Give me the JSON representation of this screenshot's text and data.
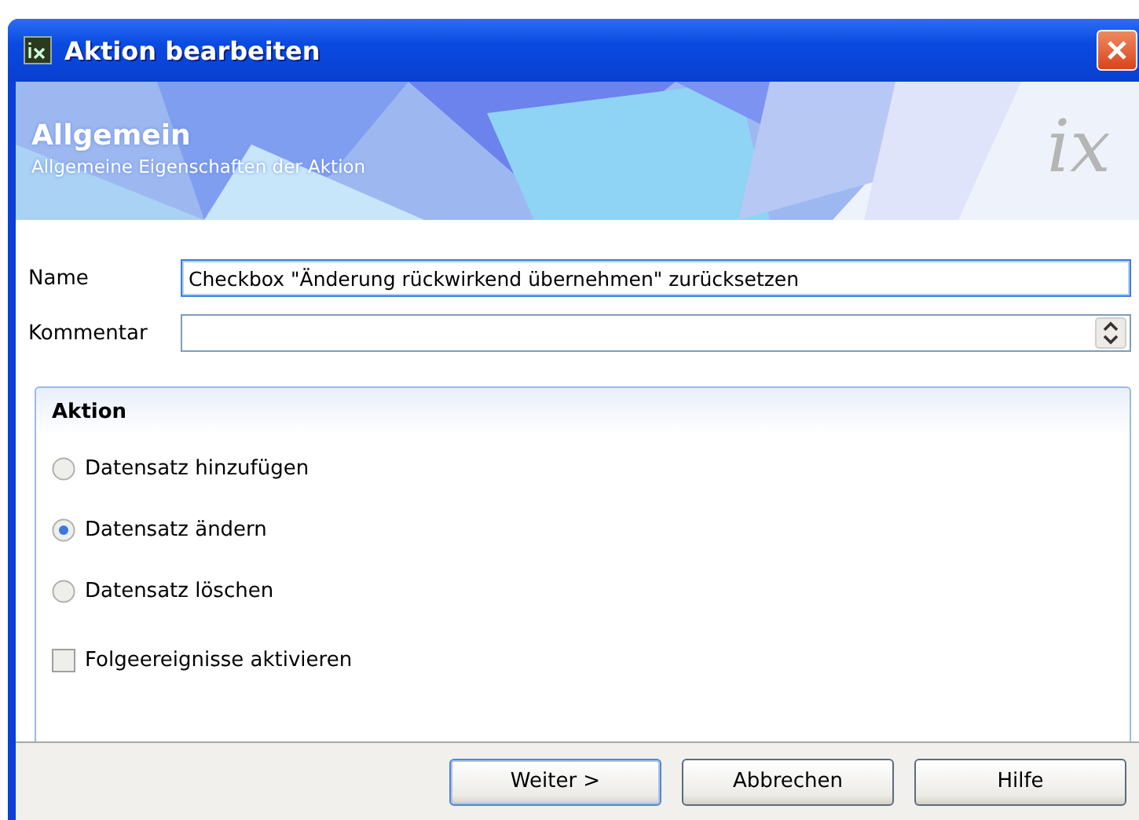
{
  "window": {
    "title": "Aktion bearbeiten"
  },
  "header": {
    "title": "Allgemein",
    "subtitle": "Allgemeine Eigenschaften der Aktion",
    "logo": "ix"
  },
  "fields": [
    {
      "label": "Name",
      "value": "Checkbox \"Änderung rückwirkend übernehmen\" zurücksetzen",
      "kind": "text",
      "focused": true
    },
    {
      "label": "Kommentar",
      "kind": "spin",
      "focused": false
    }
  ],
  "group": {
    "title": "Aktion",
    "options": [
      {
        "kind": "radio",
        "label": "Datensatz hinzufügen",
        "selected": false
      },
      {
        "kind": "radio",
        "label": "Datensatz ändern",
        "selected": true
      },
      {
        "kind": "radio",
        "label": "Datensatz löschen",
        "selected": false
      },
      {
        "kind": "checkbox",
        "label": "Folgeereignisse aktivieren",
        "checked": false
      }
    ]
  },
  "buttons": [
    {
      "label": "Weiter >",
      "default": true
    },
    {
      "label": "Abbrechen",
      "default": false
    },
    {
      "label": "Hilfe",
      "default": false
    }
  ]
}
